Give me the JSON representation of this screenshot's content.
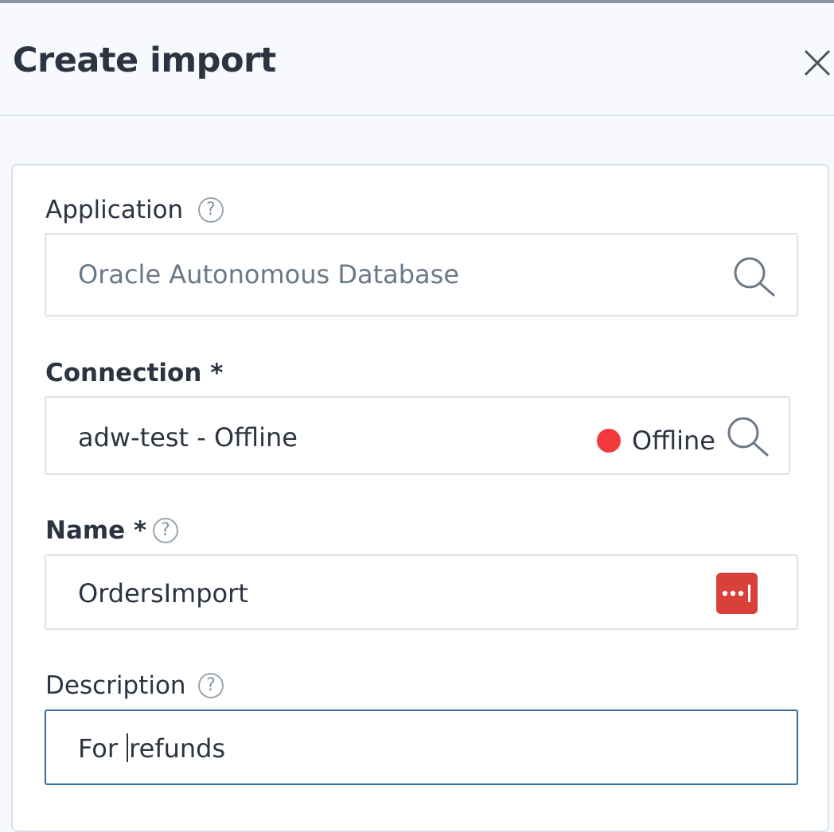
{
  "dialog": {
    "title": "Create import"
  },
  "form": {
    "application": {
      "label": "Application",
      "help_icon": "?",
      "value": "Oracle Autonomous Database",
      "icon": "search-icon"
    },
    "connection": {
      "label": "Connection *",
      "value": "adw-test - Offline",
      "status": "Offline",
      "status_color": "#f23a3c",
      "icon": "search-icon"
    },
    "name": {
      "label": "Name *",
      "help_icon": "?",
      "value": "OrdersImport",
      "icon": "password-manager-icon",
      "icon_color": "#d9403a"
    },
    "description": {
      "label": "Description",
      "help_icon": "?",
      "value_before_cursor": "For ",
      "value_after_cursor": "refunds"
    }
  }
}
